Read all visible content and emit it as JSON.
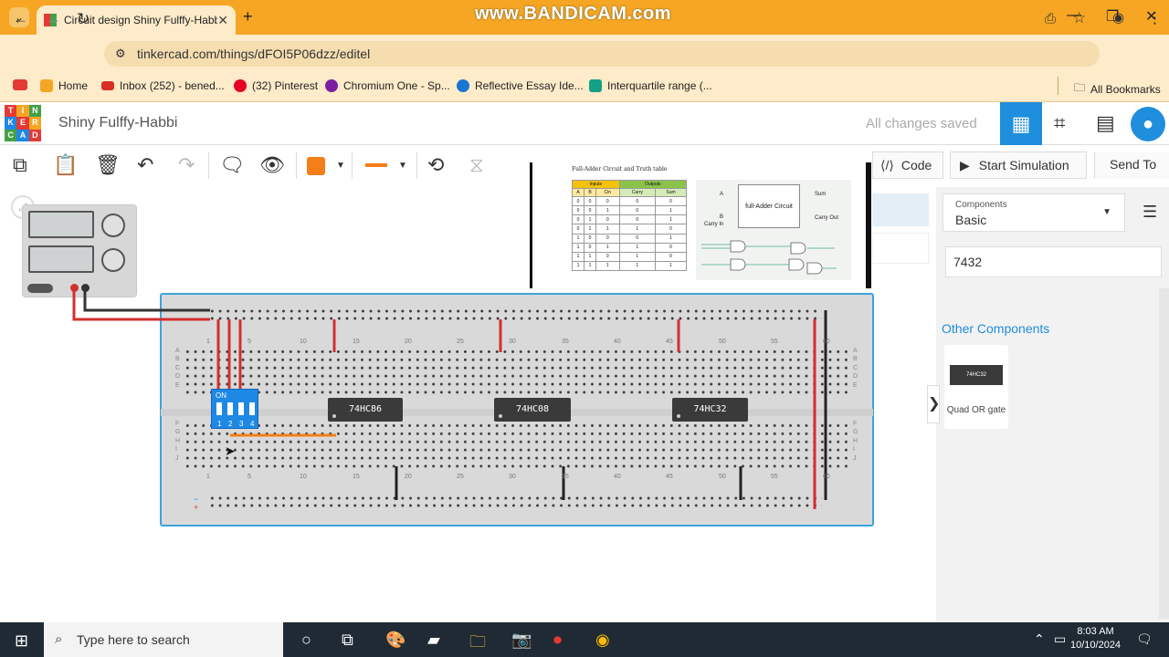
{
  "browser": {
    "tab_title": "Circuit design Shiny Fulffy-Habbi",
    "url": "tinkercad.com/things/dFOI5P06dzz/editel",
    "watermark": "www.BANDICAM.com",
    "bookmarks": [
      {
        "label": "",
        "color": "#e53935"
      },
      {
        "label": "Home",
        "color": "#1e88e5"
      },
      {
        "label": "Inbox (252) - bened...",
        "color": "#d93025"
      },
      {
        "label": "(32) Pinterest",
        "color": "#e60023"
      },
      {
        "label": "Chromium One - Sp...",
        "color": "#7b1fa2"
      },
      {
        "label": "Reflective Essay Ide...",
        "color": "#1976d2"
      },
      {
        "label": "Interquartile range (...",
        "color": "#14a085"
      }
    ],
    "all_bookmarks": "All Bookmarks"
  },
  "app": {
    "logo_letters": [
      "TIN",
      "KER",
      "CAD"
    ],
    "logo_colors": [
      "#e53935",
      "#f5a623",
      "#43a047",
      "#1e88e5"
    ],
    "project_name": "Shiny Fulffy-Habbi",
    "save_status": "All changes saved"
  },
  "toolbar": {
    "code": "Code",
    "start_simulation": "Start Simulation",
    "send_to": "Send To",
    "color": "#f47e17"
  },
  "reference": {
    "title": "Full-Adder Circuit and Truth table",
    "inputs_header": "Inputs",
    "outputs_header": "Outputs",
    "columns": [
      "A",
      "B",
      "Cin",
      "Carry",
      "Sum"
    ],
    "rows": [
      [
        "0",
        "0",
        "0",
        "0",
        "0"
      ],
      [
        "0",
        "0",
        "1",
        "0",
        "1"
      ],
      [
        "0",
        "1",
        "0",
        "0",
        "1"
      ],
      [
        "0",
        "1",
        "1",
        "1",
        "0"
      ],
      [
        "1",
        "0",
        "0",
        "0",
        "1"
      ],
      [
        "1",
        "0",
        "1",
        "1",
        "0"
      ],
      [
        "1",
        "1",
        "0",
        "1",
        "0"
      ],
      [
        "1",
        "1",
        "1",
        "1",
        "1"
      ]
    ],
    "box_label": "full-Adder Circuit",
    "in_a": "A",
    "in_b": "B",
    "carry_in": "Carry In",
    "sum": "Sum",
    "carry_out": "Carry Out"
  },
  "breadboard": {
    "column_numbers": [
      "1",
      "5",
      "10",
      "15",
      "20",
      "25",
      "30",
      "35",
      "40",
      "45",
      "50",
      "55",
      "60"
    ],
    "row_letters_top": [
      "A",
      "B",
      "C",
      "D",
      "E"
    ],
    "row_letters_bottom": [
      "F",
      "G",
      "H",
      "I",
      "J"
    ],
    "chips": [
      "74HC86",
      "74HC08",
      "74HC32"
    ],
    "dip_label": "ON",
    "dip_numbers": [
      "1",
      "2",
      "3",
      "4"
    ]
  },
  "panel": {
    "components_label": "Components",
    "components_value": "Basic",
    "search_value": "7432",
    "other_components": "Other Components",
    "tile_chip": "74HC32",
    "tile_label": "Quad OR gate"
  },
  "taskbar": {
    "search_placeholder": "Type here to search",
    "time": "8:03 AM",
    "date": "10/10/2024"
  }
}
